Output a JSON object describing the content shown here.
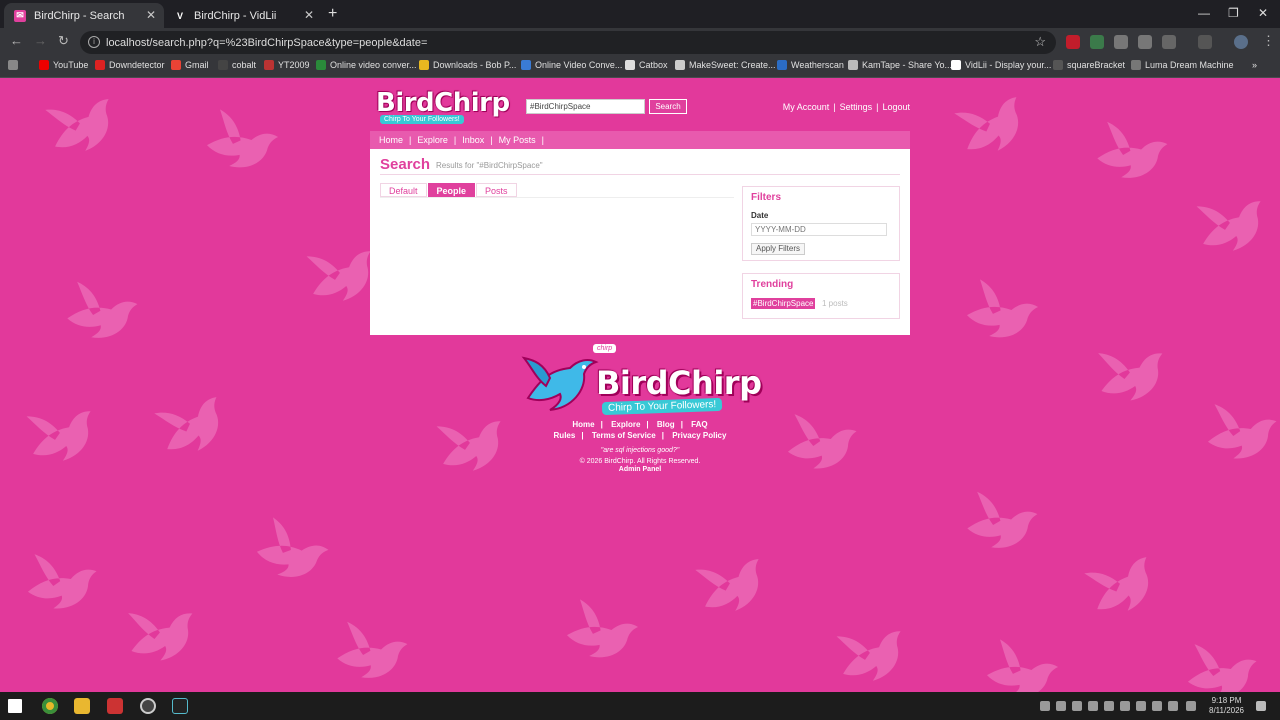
{
  "browser": {
    "tabs": [
      {
        "title": "BirdChirp - Search",
        "active": true
      },
      {
        "title": "BirdChirp - VidLii",
        "active": false
      }
    ],
    "url": "localhost/search.php?q=%23BirdChirpSpace&type=people&date=",
    "bookmarks": [
      "YouTube",
      "Downdetector",
      "Gmail",
      "cobalt",
      "YT2009",
      "Online video conver...",
      "Downloads - Bob P...",
      "Online Video Conve...",
      "Catbox",
      "MakeSweet: Create...",
      "Weatherscan",
      "KamTape - Share Yo...",
      "VidLii - Display your...",
      "squareBracket",
      "Luma Dream Machine"
    ]
  },
  "site": {
    "logo_text": "BirdChirp",
    "logo_tagline": "Chirp To Your Followers!",
    "search_value": "#BirdChirpSpace",
    "search_button": "Search",
    "account_links": [
      "My Account",
      "Settings",
      "Logout"
    ],
    "nav": [
      "Home",
      "Explore",
      "Inbox",
      "My Posts"
    ]
  },
  "page": {
    "title": "Search",
    "results_for": "Results for \"#BirdChirpSpace\"",
    "tabs": [
      {
        "label": "Default",
        "active": false
      },
      {
        "label": "People",
        "active": true
      },
      {
        "label": "Posts",
        "active": false
      }
    ],
    "filters": {
      "heading": "Filters",
      "date_label": "Date",
      "date_placeholder": "YYYY-MM-DD",
      "apply_button": "Apply Filters"
    },
    "trending": {
      "heading": "Trending",
      "tag": "#BirdChirpSpace",
      "count": "1 posts"
    }
  },
  "footer": {
    "bubble": "chirp",
    "links_row1": [
      "Home",
      "Explore",
      "Blog",
      "FAQ"
    ],
    "links_row2": [
      "Rules",
      "Terms of Service",
      "Privacy Policy"
    ],
    "quote": "\"are sql injections good?\"",
    "copyright": "© 2026 BirdChirp. All Rights Reserved.",
    "admin": "Admin Panel"
  },
  "taskbar": {
    "time": "9:18 PM",
    "date": "8/11/2026"
  },
  "colors": {
    "brand_pink": "#e0409d",
    "background_pink": "#e2399b",
    "accent_cyan": "#38c9d6"
  }
}
